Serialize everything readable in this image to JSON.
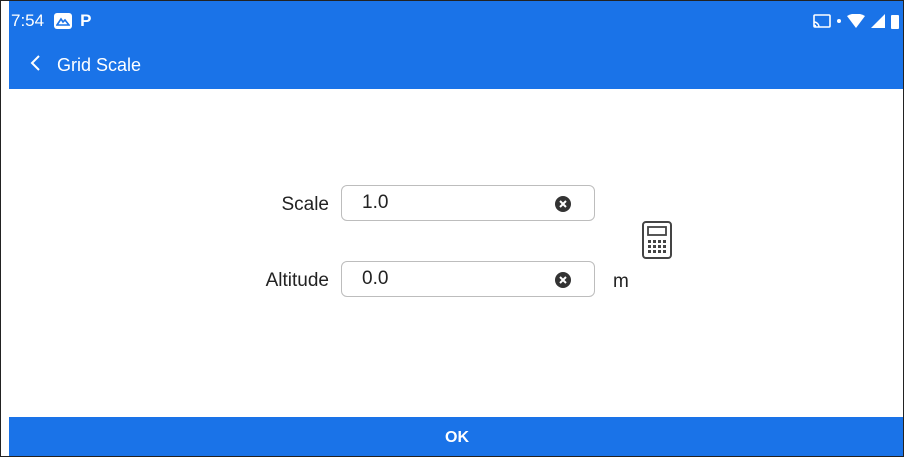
{
  "status_bar": {
    "time": "7:54",
    "badge_icon": "mountain-icon",
    "p_label": "P",
    "icons": [
      "cast-icon",
      "wifi-icon",
      "signal-icon",
      "battery-icon"
    ]
  },
  "app_bar": {
    "back_icon": "chevron-left-icon",
    "title": "Grid Scale"
  },
  "form": {
    "scale": {
      "label": "Scale",
      "value": "1.0"
    },
    "altitude": {
      "label": "Altitude",
      "value": "0.0",
      "unit": "m"
    },
    "calculator_icon": "calculator-icon"
  },
  "footer": {
    "ok_label": "OK"
  },
  "colors": {
    "accent": "#1a73e8",
    "field_border": "#bdbdbd",
    "text": "#222222"
  }
}
